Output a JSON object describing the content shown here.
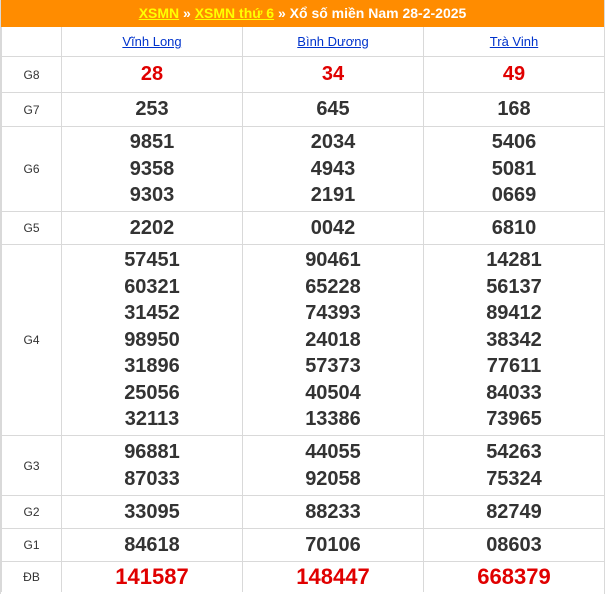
{
  "header": {
    "link1": "XSMN",
    "sep1": "»",
    "link2": "XSMN thứ 6",
    "sep2": "»",
    "title": "Xổ số miền Nam 28-2-2025"
  },
  "provinces": [
    "Vĩnh Long",
    "Bình Dương",
    "Trà Vinh"
  ],
  "prizes": [
    {
      "label": "G8",
      "results": [
        [
          "28"
        ],
        [
          "34"
        ],
        [
          "49"
        ]
      ]
    },
    {
      "label": "G7",
      "results": [
        [
          "253"
        ],
        [
          "645"
        ],
        [
          "168"
        ]
      ]
    },
    {
      "label": "G6",
      "results": [
        [
          "9851",
          "9358",
          "9303"
        ],
        [
          "2034",
          "4943",
          "2191"
        ],
        [
          "5406",
          "5081",
          "0669"
        ]
      ]
    },
    {
      "label": "G5",
      "results": [
        [
          "2202"
        ],
        [
          "0042"
        ],
        [
          "6810"
        ]
      ]
    },
    {
      "label": "G4",
      "results": [
        [
          "57451",
          "60321",
          "31452",
          "98950",
          "31896",
          "25056",
          "32113"
        ],
        [
          "90461",
          "65228",
          "74393",
          "24018",
          "57373",
          "40504",
          "13386"
        ],
        [
          "14281",
          "56137",
          "89412",
          "38342",
          "77611",
          "84033",
          "73965"
        ]
      ]
    },
    {
      "label": "G3",
      "results": [
        [
          "96881",
          "87033"
        ],
        [
          "44055",
          "92058"
        ],
        [
          "54263",
          "75324"
        ]
      ]
    },
    {
      "label": "G2",
      "results": [
        [
          "33095"
        ],
        [
          "88233"
        ],
        [
          "82749"
        ]
      ]
    },
    {
      "label": "G1",
      "results": [
        [
          "84618"
        ],
        [
          "70106"
        ],
        [
          "08603"
        ]
      ]
    },
    {
      "label": "ĐB",
      "results": [
        [
          "141587"
        ],
        [
          "148447"
        ],
        [
          "668379"
        ]
      ]
    }
  ],
  "colors": {
    "header_bg": "#ff8c00",
    "header_link": "#ffff00",
    "highlight": "#e00000",
    "province_link": "#0033cc"
  }
}
